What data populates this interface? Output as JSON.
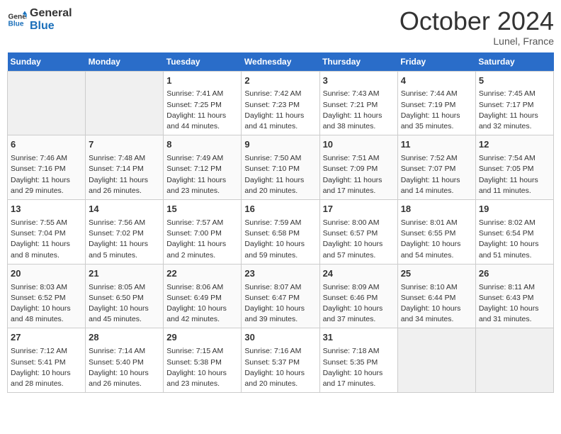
{
  "header": {
    "logo_line1": "General",
    "logo_line2": "Blue",
    "month": "October 2024",
    "location": "Lunel, France"
  },
  "days_of_week": [
    "Sunday",
    "Monday",
    "Tuesday",
    "Wednesday",
    "Thursday",
    "Friday",
    "Saturday"
  ],
  "weeks": [
    [
      {
        "day": "",
        "empty": true
      },
      {
        "day": "",
        "empty": true
      },
      {
        "day": "1",
        "sunrise": "Sunrise: 7:41 AM",
        "sunset": "Sunset: 7:25 PM",
        "daylight": "Daylight: 11 hours and 44 minutes."
      },
      {
        "day": "2",
        "sunrise": "Sunrise: 7:42 AM",
        "sunset": "Sunset: 7:23 PM",
        "daylight": "Daylight: 11 hours and 41 minutes."
      },
      {
        "day": "3",
        "sunrise": "Sunrise: 7:43 AM",
        "sunset": "Sunset: 7:21 PM",
        "daylight": "Daylight: 11 hours and 38 minutes."
      },
      {
        "day": "4",
        "sunrise": "Sunrise: 7:44 AM",
        "sunset": "Sunset: 7:19 PM",
        "daylight": "Daylight: 11 hours and 35 minutes."
      },
      {
        "day": "5",
        "sunrise": "Sunrise: 7:45 AM",
        "sunset": "Sunset: 7:17 PM",
        "daylight": "Daylight: 11 hours and 32 minutes."
      }
    ],
    [
      {
        "day": "6",
        "sunrise": "Sunrise: 7:46 AM",
        "sunset": "Sunset: 7:16 PM",
        "daylight": "Daylight: 11 hours and 29 minutes."
      },
      {
        "day": "7",
        "sunrise": "Sunrise: 7:48 AM",
        "sunset": "Sunset: 7:14 PM",
        "daylight": "Daylight: 11 hours and 26 minutes."
      },
      {
        "day": "8",
        "sunrise": "Sunrise: 7:49 AM",
        "sunset": "Sunset: 7:12 PM",
        "daylight": "Daylight: 11 hours and 23 minutes."
      },
      {
        "day": "9",
        "sunrise": "Sunrise: 7:50 AM",
        "sunset": "Sunset: 7:10 PM",
        "daylight": "Daylight: 11 hours and 20 minutes."
      },
      {
        "day": "10",
        "sunrise": "Sunrise: 7:51 AM",
        "sunset": "Sunset: 7:09 PM",
        "daylight": "Daylight: 11 hours and 17 minutes."
      },
      {
        "day": "11",
        "sunrise": "Sunrise: 7:52 AM",
        "sunset": "Sunset: 7:07 PM",
        "daylight": "Daylight: 11 hours and 14 minutes."
      },
      {
        "day": "12",
        "sunrise": "Sunrise: 7:54 AM",
        "sunset": "Sunset: 7:05 PM",
        "daylight": "Daylight: 11 hours and 11 minutes."
      }
    ],
    [
      {
        "day": "13",
        "sunrise": "Sunrise: 7:55 AM",
        "sunset": "Sunset: 7:04 PM",
        "daylight": "Daylight: 11 hours and 8 minutes."
      },
      {
        "day": "14",
        "sunrise": "Sunrise: 7:56 AM",
        "sunset": "Sunset: 7:02 PM",
        "daylight": "Daylight: 11 hours and 5 minutes."
      },
      {
        "day": "15",
        "sunrise": "Sunrise: 7:57 AM",
        "sunset": "Sunset: 7:00 PM",
        "daylight": "Daylight: 11 hours and 2 minutes."
      },
      {
        "day": "16",
        "sunrise": "Sunrise: 7:59 AM",
        "sunset": "Sunset: 6:58 PM",
        "daylight": "Daylight: 10 hours and 59 minutes."
      },
      {
        "day": "17",
        "sunrise": "Sunrise: 8:00 AM",
        "sunset": "Sunset: 6:57 PM",
        "daylight": "Daylight: 10 hours and 57 minutes."
      },
      {
        "day": "18",
        "sunrise": "Sunrise: 8:01 AM",
        "sunset": "Sunset: 6:55 PM",
        "daylight": "Daylight: 10 hours and 54 minutes."
      },
      {
        "day": "19",
        "sunrise": "Sunrise: 8:02 AM",
        "sunset": "Sunset: 6:54 PM",
        "daylight": "Daylight: 10 hours and 51 minutes."
      }
    ],
    [
      {
        "day": "20",
        "sunrise": "Sunrise: 8:03 AM",
        "sunset": "Sunset: 6:52 PM",
        "daylight": "Daylight: 10 hours and 48 minutes."
      },
      {
        "day": "21",
        "sunrise": "Sunrise: 8:05 AM",
        "sunset": "Sunset: 6:50 PM",
        "daylight": "Daylight: 10 hours and 45 minutes."
      },
      {
        "day": "22",
        "sunrise": "Sunrise: 8:06 AM",
        "sunset": "Sunset: 6:49 PM",
        "daylight": "Daylight: 10 hours and 42 minutes."
      },
      {
        "day": "23",
        "sunrise": "Sunrise: 8:07 AM",
        "sunset": "Sunset: 6:47 PM",
        "daylight": "Daylight: 10 hours and 39 minutes."
      },
      {
        "day": "24",
        "sunrise": "Sunrise: 8:09 AM",
        "sunset": "Sunset: 6:46 PM",
        "daylight": "Daylight: 10 hours and 37 minutes."
      },
      {
        "day": "25",
        "sunrise": "Sunrise: 8:10 AM",
        "sunset": "Sunset: 6:44 PM",
        "daylight": "Daylight: 10 hours and 34 minutes."
      },
      {
        "day": "26",
        "sunrise": "Sunrise: 8:11 AM",
        "sunset": "Sunset: 6:43 PM",
        "daylight": "Daylight: 10 hours and 31 minutes."
      }
    ],
    [
      {
        "day": "27",
        "sunrise": "Sunrise: 7:12 AM",
        "sunset": "Sunset: 5:41 PM",
        "daylight": "Daylight: 10 hours and 28 minutes."
      },
      {
        "day": "28",
        "sunrise": "Sunrise: 7:14 AM",
        "sunset": "Sunset: 5:40 PM",
        "daylight": "Daylight: 10 hours and 26 minutes."
      },
      {
        "day": "29",
        "sunrise": "Sunrise: 7:15 AM",
        "sunset": "Sunset: 5:38 PM",
        "daylight": "Daylight: 10 hours and 23 minutes."
      },
      {
        "day": "30",
        "sunrise": "Sunrise: 7:16 AM",
        "sunset": "Sunset: 5:37 PM",
        "daylight": "Daylight: 10 hours and 20 minutes."
      },
      {
        "day": "31",
        "sunrise": "Sunrise: 7:18 AM",
        "sunset": "Sunset: 5:35 PM",
        "daylight": "Daylight: 10 hours and 17 minutes."
      },
      {
        "day": "",
        "empty": true
      },
      {
        "day": "",
        "empty": true
      }
    ]
  ]
}
